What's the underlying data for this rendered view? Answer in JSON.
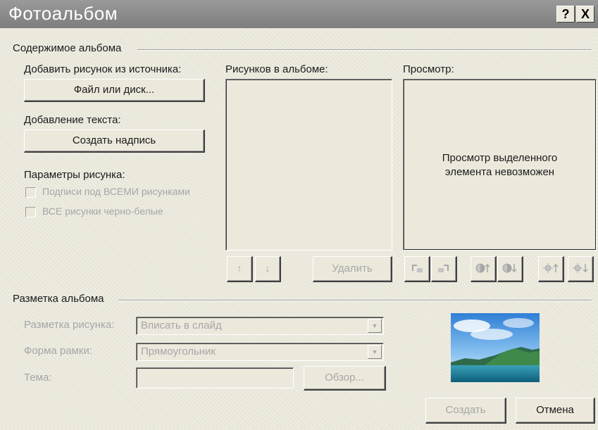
{
  "window": {
    "title": "Фотоальбом",
    "help": "?",
    "close": "X"
  },
  "content_group": {
    "title": "Содержимое альбома",
    "insert_from_label": "Добавить рисунок из источника:",
    "file_disk_button": "Файл или диск...",
    "insert_text_label": "Добавление текста:",
    "new_textbox_button": "Создать надпись",
    "picture_options_label": "Параметры рисунка:",
    "captions_checkbox": "Подписи под ВСЕМИ рисунками",
    "captions_checked": false,
    "bw_checkbox": "ВСЕ рисунки черно-белые",
    "bw_checked": false,
    "pictures_label": "Рисунков в альбоме:",
    "move_up": "↑",
    "move_down": "↓",
    "remove_button": "Удалить",
    "preview_label": "Просмотр:",
    "preview_message": "Просмотр выделенного элемента невозможен"
  },
  "layout_group": {
    "title": "Разметка альбома",
    "picture_layout_label": "Разметка рисунка:",
    "picture_layout_value": "Вписать в слайд",
    "frame_shape_label": "Форма рамки:",
    "frame_shape_value": "Прямоугольник",
    "theme_label": "Тема:",
    "theme_value": "",
    "browse_button": "Обзор..."
  },
  "footer": {
    "create_button": "Создать",
    "cancel_button": "Отмена"
  },
  "colors": {
    "dialog_bg": "#ece9dc",
    "titlebar": "#8a8a8a",
    "disabled_text": "#a6a6a6"
  }
}
